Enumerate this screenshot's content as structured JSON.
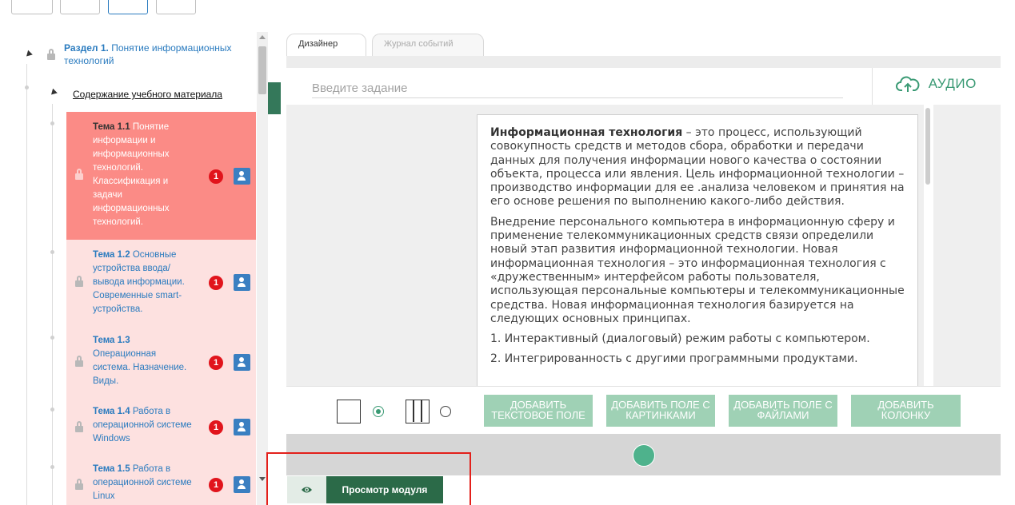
{
  "tree": {
    "section_num": "Раздел 1.",
    "section_name": "Понятие информационных технологий",
    "subsection": "Содержание учебного материала",
    "topics": [
      {
        "num": "Тема 1.1",
        "lines": [
          "Понятие",
          "информации и",
          "информационных",
          "технологий.",
          "Классификация и",
          "задачи",
          "информационных",
          "технологий."
        ],
        "badge": "1",
        "active": true
      },
      {
        "num": "Тема 1.2",
        "lines": [
          "Основные",
          "устройства ввода/",
          "вывода информации.",
          "Современные smart-",
          "устройства."
        ],
        "badge": "1",
        "active": false
      },
      {
        "num": "Тема 1.3",
        "lines": [
          "Операционная",
          "система. Назначение.",
          "Виды."
        ],
        "badge": "1",
        "active": false
      },
      {
        "num": "Тема 1.4",
        "lines": [
          "Работа в",
          "операционной системе",
          "Windows"
        ],
        "badge": "1",
        "active": false
      },
      {
        "num": "Тема 1.5",
        "lines": [
          "Работа в",
          "операционной системе",
          "Linux"
        ],
        "badge": "1",
        "active": false
      }
    ]
  },
  "tabs": {
    "designer": "Дизайнер",
    "events_log": "Журнал событий"
  },
  "task": {
    "placeholder": "Введите задание"
  },
  "audio": {
    "label": "АУДИО"
  },
  "content": {
    "term": "Информационная технология",
    "para1_rest": " – это процесс, использующий совокупность средств и методов сбора, обработки и передачи данных для получения информации нового качества о состоянии объекта, процесса или явления. Цель информационной технологии – производство информации для ее .анализа человеком и принятия на его основе решения по выполнению какого-либо действия.",
    "para2": "Внедрение персонального компьютера в информационную сферу и применение телекоммуникационных средств связи определили новый этап развития информационной технологии. Новая информационная технология – это информационная технология с «дружественным» интерфейсом работы пользователя, использующая персональные компьютеры и телекоммуникационные средства. Новая информационная технология базируется на следующих основных принципах.",
    "item1": "1. Интерактивный (диалоговый) режим работы с компьютером.",
    "item2": "2. Интегрированность с другими программными продуктами."
  },
  "buttons": {
    "add_text": "ДОБАВИТЬ ТЕКСТОВОЕ ПОЛЕ",
    "add_images": "ДОБАВИТЬ ПОЛЕ С КАРТИНКАМИ",
    "add_files": "ДОБАВИТЬ ПОЛЕ С ФАЙЛАМИ",
    "add_column": "ДОБАВИТЬ КОЛОНКУ"
  },
  "preview": {
    "label": "Просмотр модуля"
  },
  "colors": {
    "accent": "#2b6a48",
    "button_green": "#9fd1b5",
    "active_topic": "#fb8b86",
    "topic_bg": "#fde1e0",
    "badge": "#e1141c",
    "highlight": "#e3201b"
  }
}
